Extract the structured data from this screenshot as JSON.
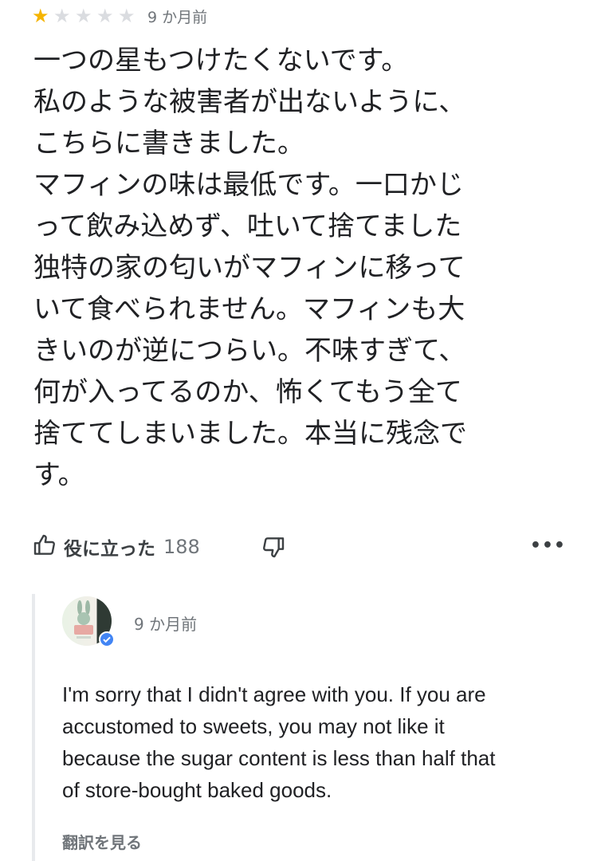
{
  "review": {
    "rating": 1,
    "max_rating": 5,
    "time": "9 か月前",
    "body_lines": [
      "一つの星もつけたくないです。",
      "私のような被害者が出ないように、",
      "こちらに書きました。",
      "マフィンの味は最低です。一口かじ",
      "って飲み込めず、吐いて捨てました",
      "独特の家の匂いがマフィンに移って",
      "いて食べられません。マフィンも大",
      "きいのが逆につらい。不味すぎて、",
      "何が入ってるのか、怖くてもう全て",
      "捨ててしまいました。本当に残念で",
      "す。"
    ]
  },
  "actions": {
    "helpful_label": "役に立った",
    "helpful_count": "188",
    "more_label": "•••"
  },
  "reply": {
    "time": "9 か月前",
    "body_lines": [
      "I'm sorry that I didn't agree with you.  If you are",
      "accustomed to sweets, you may not like it",
      "because the sugar content is less than half that",
      "of store-bought baked goods."
    ],
    "translate_label": "翻訳を見る"
  },
  "icons": {
    "star": "star-icon",
    "thumb_up": "thumb-up-icon",
    "thumb_down": "thumb-down-icon",
    "more": "more-horiz-icon",
    "verified": "verified-badge-icon"
  },
  "colors": {
    "star_filled": "#f5b400",
    "star_empty": "#dadce0",
    "verified": "#4285f4",
    "muted_text": "#70757a"
  }
}
